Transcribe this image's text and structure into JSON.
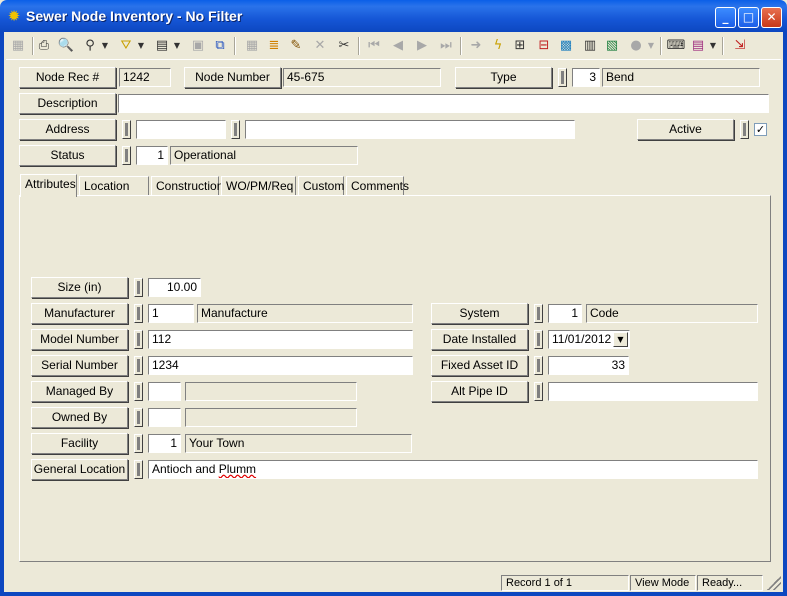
{
  "window": {
    "title": "Sewer Node Inventory - No Filter"
  },
  "header": {
    "node_rec_label": "Node Rec #",
    "node_rec_value": "1242",
    "node_number_label": "Node Number",
    "node_number_value": "45-675",
    "type_label": "Type",
    "type_code": "3",
    "type_name": "Bend",
    "description_label": "Description",
    "description_value": "",
    "address_label": "Address",
    "address_number": "",
    "address_street": "",
    "active_label": "Active",
    "active_checked": true,
    "active_mark": "✓",
    "status_label": "Status",
    "status_code": "1",
    "status_name": "Operational"
  },
  "tabs": [
    {
      "label": "Attributes",
      "active": true
    },
    {
      "label": "Location"
    },
    {
      "label": "Construction"
    },
    {
      "label": "WO/PM/Req"
    },
    {
      "label": "Custom"
    },
    {
      "label": "Comments"
    }
  ],
  "attributes": {
    "size_label": "Size (in)",
    "size_value": "10.00",
    "manufacturer_label": "Manufacturer",
    "manufacturer_code": "1",
    "manufacturer_name": "Manufacture",
    "model_label": "Model Number",
    "model_value": "112",
    "serial_label": "Serial Number",
    "serial_value": "1234",
    "managed_label": "Managed By",
    "managed_code": "",
    "managed_name": "",
    "owned_label": "Owned By",
    "owned_code": "",
    "owned_name": "",
    "facility_label": "Facility",
    "facility_code": "1",
    "facility_name": "Your Town",
    "general_location_label": "General Location",
    "general_location_value_a": "Antioch and ",
    "general_location_value_b": "Plumm",
    "system_label": "System",
    "system_code": "1",
    "system_name": "Code",
    "date_installed_label": "Date Installed",
    "date_installed_value": "11/01/2012",
    "fixed_asset_label": "Fixed Asset ID",
    "fixed_asset_value": "33",
    "alt_pipe_label": "Alt Pipe ID",
    "alt_pipe_value": ""
  },
  "status_bar": {
    "record": "Record 1 of 1",
    "mode": "View Mode",
    "state": "Ready..."
  },
  "icons": {
    "app": "sewer-gear-icon",
    "dropdown_arrow": "▼"
  },
  "colors": {
    "titlebar": "#0d47c0",
    "face": "#ece9d8",
    "spellcheck": "#e00000"
  }
}
